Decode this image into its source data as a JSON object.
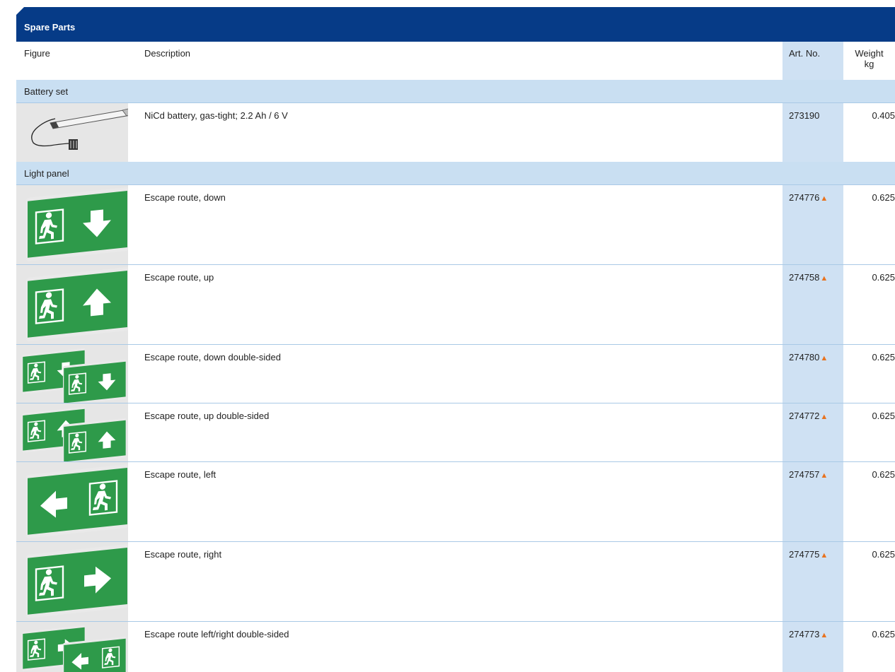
{
  "header": {
    "title": "Spare Parts"
  },
  "columns": {
    "figure": "Figure",
    "description": "Description",
    "art_no": "Art. No.",
    "weight": "Weight",
    "weight_unit": "kg"
  },
  "groups": {
    "battery": {
      "label": "Battery set",
      "items": [
        {
          "description": "NiCd battery, gas-tight; 2.2 Ah / 6 V",
          "art_no": "273190",
          "weight": "0.405",
          "figure_icon": "battery-pack-icon"
        }
      ]
    },
    "panel": {
      "label": "Light panel",
      "items": [
        {
          "description": "Escape route, down",
          "art_no": "274776",
          "weight": "0.625",
          "figure_icon": "exit-sign-down-icon"
        },
        {
          "description": "Escape route, up",
          "art_no": "274758",
          "weight": "0.625",
          "figure_icon": "exit-sign-up-icon"
        },
        {
          "description": "Escape route, down double-sided",
          "art_no": "274780",
          "weight": "0.625",
          "figure_icon": "exit-sign-down-double-icon"
        },
        {
          "description": "Escape route, up double-sided",
          "art_no": "274772",
          "weight": "0.625",
          "figure_icon": "exit-sign-up-double-icon"
        },
        {
          "description": "Escape route, left",
          "art_no": "274757",
          "weight": "0.625",
          "figure_icon": "exit-sign-left-icon"
        },
        {
          "description": "Escape route, right",
          "art_no": "274775",
          "weight": "0.625",
          "figure_icon": "exit-sign-right-icon"
        },
        {
          "description": "Escape route left/right double-sided",
          "art_no": "274773",
          "weight": "0.625",
          "figure_icon": "exit-sign-left-right-double-icon"
        }
      ]
    }
  },
  "marker": "▲",
  "colors": {
    "header_bg": "#063b87",
    "group_bg": "#c9dff2",
    "art_col_bg": "#cfe1f3",
    "marker": "#e8731f",
    "sign_green": "#2e9a4a"
  }
}
